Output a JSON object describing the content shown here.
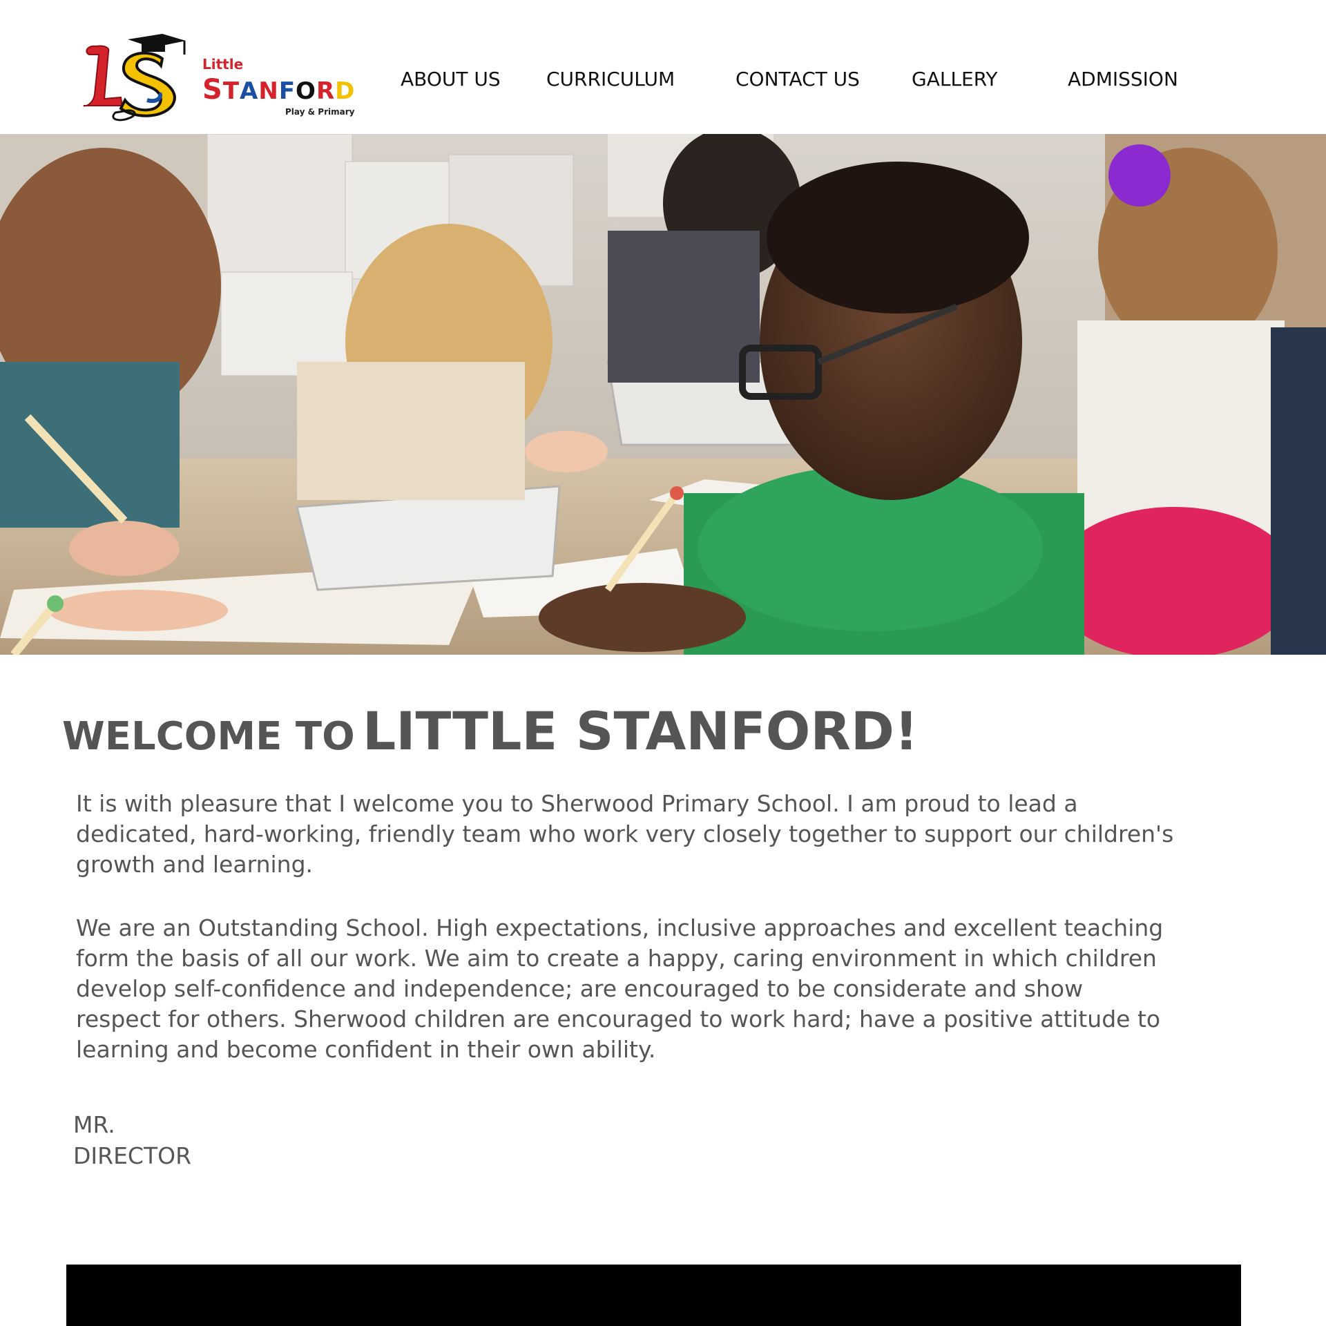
{
  "logo": {
    "monogram": "LS",
    "word_little": "Little",
    "word_stanford": [
      "S",
      "T",
      "A",
      "N",
      "F",
      "O",
      "R",
      "D"
    ],
    "tagline": "Play & Primary",
    "colors": [
      "#d4232a",
      "#f2c200",
      "#1a4fa3",
      "#222222"
    ]
  },
  "nav": {
    "items": [
      {
        "label": "ABOUT US"
      },
      {
        "label": "CURRICULUM"
      },
      {
        "label": "CONTACT US"
      },
      {
        "label": "GALLERY"
      },
      {
        "label": "ADMISSION"
      }
    ]
  },
  "hero": {
    "alt": "",
    "colors": {
      "shirt": "#2a9a55",
      "skirt": "#e0245e",
      "table": "#cdb99b",
      "wall": "#d9d4cc"
    }
  },
  "welcome": {
    "title_small": "WELCOME TO",
    "title_big": "LITTLE STANFORD!",
    "paragraph_1": "It is with pleasure that I welcome you to Sherwood Primary School. I am proud to lead a dedicated, hard-working, friendly team who work very closely together to support our children's growth and learning.",
    "paragraph_2_lead": "We are an Outstanding School",
    "paragraph_2_rest": ". High expectations, inclusive approaches and excellent teaching form the basis of all our work. We aim to create a happy, caring environment in which children develop self-confidence and independence; are encouraged to be considerate and show respect for others. Sherwood children are encouraged to work hard; have a positive attitude to learning and become confident in their own ability.",
    "signature_line_1": "MR.",
    "signature_line_2": "DIRECTOR"
  },
  "colors": {
    "text": "#555555",
    "nav_text": "#111111",
    "footer": "#000000"
  }
}
